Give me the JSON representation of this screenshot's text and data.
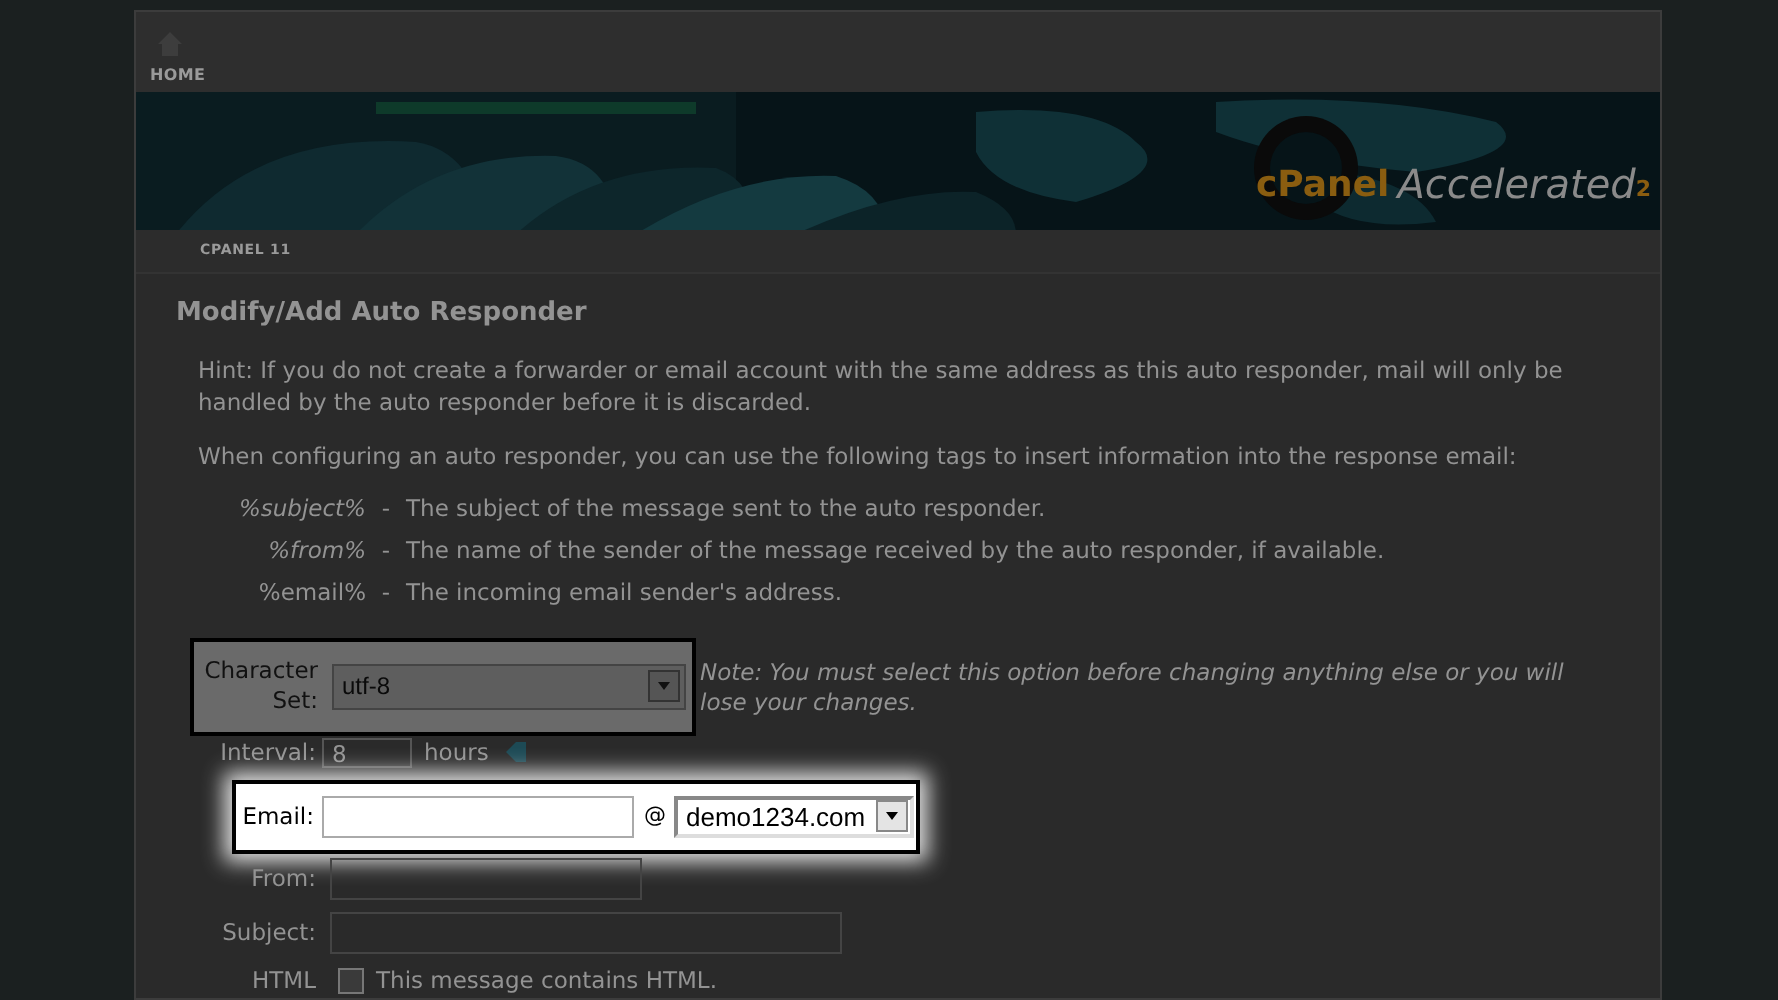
{
  "nav": {
    "home": "HOME"
  },
  "banner": {
    "brand": "cPanel",
    "product": "Accelerated",
    "version": "2"
  },
  "breadcrumb": "CPANEL 11",
  "heading": "Modify/Add Auto Responder",
  "hint": "Hint: If you do not create a forwarder or email account with the same address as this auto responder, mail will only be handled by the auto responder before it is discarded.",
  "tags_intro": "When configuring an auto responder, you can use the following tags to insert information into the response email:",
  "tags": [
    {
      "tag": "%subject%",
      "italic": true,
      "dash": "-",
      "description": "The subject of the message sent to the auto responder."
    },
    {
      "tag": "%from%",
      "italic": true,
      "dash": "-",
      "description": "The name of the sender of the message received by the auto responder, if available."
    },
    {
      "tag": "%email%",
      "italic": false,
      "dash": "-",
      "description": "The incoming email sender's address."
    }
  ],
  "fields": [
    {
      "kind": "select",
      "label": "Character Set:",
      "value": "utf-8",
      "note": "Note: You must select this option before changing anything else or you will lose your changes.",
      "highlighted": true
    },
    {
      "kind": "interval",
      "label": "Interval:",
      "value": "8",
      "unit": "hours"
    },
    {
      "kind": "email",
      "label": "Email:",
      "at": "@",
      "domain": "demo1234.com",
      "highlighted": true
    },
    {
      "kind": "text",
      "label": "From:",
      "wide": false
    },
    {
      "kind": "text",
      "label": "Subject:",
      "wide": true
    },
    {
      "kind": "checkbox",
      "label": "HTML",
      "text": "This message contains HTML.",
      "checked": false
    }
  ]
}
